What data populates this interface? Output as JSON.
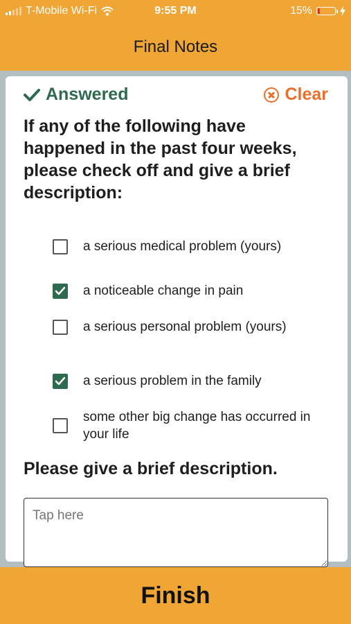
{
  "status_bar": {
    "carrier": "T-Mobile Wi-Fi",
    "time": "9:55 PM",
    "battery": "15%",
    "battery_level": 0.15,
    "battery_color": "#e0312b"
  },
  "nav": {
    "title": "Final Notes"
  },
  "card": {
    "answered_label": "Answered",
    "clear_label": "Clear",
    "question": "If any of the following have happened in the past four weeks, please check off and give a brief description:",
    "options": [
      {
        "label": "a serious medical problem (yours)",
        "checked": false
      },
      {
        "label": "a noticeable change in pain",
        "checked": true
      },
      {
        "label": "a serious personal problem (yours)",
        "checked": false
      },
      {
        "label": "a serious problem in the family",
        "checked": true
      },
      {
        "label": "some other big change has occurred in your life",
        "checked": false
      }
    ],
    "description_label": "Please give a brief description.",
    "description_placeholder": "Tap here",
    "description_value": ""
  },
  "footer": {
    "finish_label": "Finish"
  },
  "colors": {
    "accent": "#f0a634",
    "answered": "#2e6b4e",
    "clear": "#e8702a"
  },
  "icons": {
    "answered": "checkmark-icon",
    "clear": "clear-circle-x-icon",
    "wifi": "wifi-icon",
    "charging": "bolt-icon"
  }
}
